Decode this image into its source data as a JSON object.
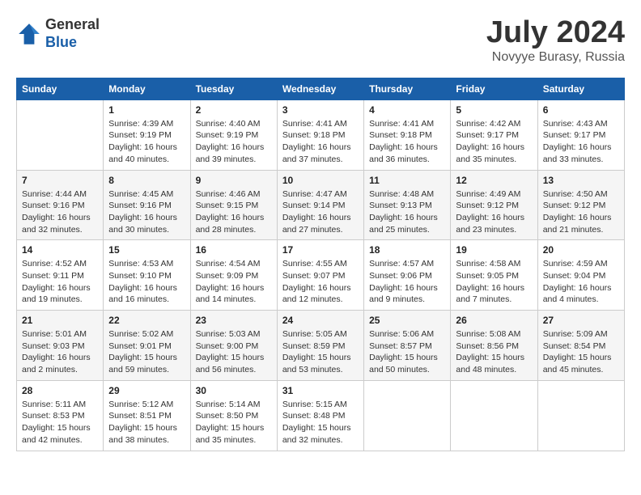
{
  "header": {
    "logo_general": "General",
    "logo_blue": "Blue",
    "month_title": "July 2024",
    "location": "Novyye Burasy, Russia"
  },
  "weekdays": [
    "Sunday",
    "Monday",
    "Tuesday",
    "Wednesday",
    "Thursday",
    "Friday",
    "Saturday"
  ],
  "weeks": [
    [
      {
        "day": "",
        "info": ""
      },
      {
        "day": "1",
        "info": "Sunrise: 4:39 AM\nSunset: 9:19 PM\nDaylight: 16 hours\nand 40 minutes."
      },
      {
        "day": "2",
        "info": "Sunrise: 4:40 AM\nSunset: 9:19 PM\nDaylight: 16 hours\nand 39 minutes."
      },
      {
        "day": "3",
        "info": "Sunrise: 4:41 AM\nSunset: 9:18 PM\nDaylight: 16 hours\nand 37 minutes."
      },
      {
        "day": "4",
        "info": "Sunrise: 4:41 AM\nSunset: 9:18 PM\nDaylight: 16 hours\nand 36 minutes."
      },
      {
        "day": "5",
        "info": "Sunrise: 4:42 AM\nSunset: 9:17 PM\nDaylight: 16 hours\nand 35 minutes."
      },
      {
        "day": "6",
        "info": "Sunrise: 4:43 AM\nSunset: 9:17 PM\nDaylight: 16 hours\nand 33 minutes."
      }
    ],
    [
      {
        "day": "7",
        "info": "Sunrise: 4:44 AM\nSunset: 9:16 PM\nDaylight: 16 hours\nand 32 minutes."
      },
      {
        "day": "8",
        "info": "Sunrise: 4:45 AM\nSunset: 9:16 PM\nDaylight: 16 hours\nand 30 minutes."
      },
      {
        "day": "9",
        "info": "Sunrise: 4:46 AM\nSunset: 9:15 PM\nDaylight: 16 hours\nand 28 minutes."
      },
      {
        "day": "10",
        "info": "Sunrise: 4:47 AM\nSunset: 9:14 PM\nDaylight: 16 hours\nand 27 minutes."
      },
      {
        "day": "11",
        "info": "Sunrise: 4:48 AM\nSunset: 9:13 PM\nDaylight: 16 hours\nand 25 minutes."
      },
      {
        "day": "12",
        "info": "Sunrise: 4:49 AM\nSunset: 9:12 PM\nDaylight: 16 hours\nand 23 minutes."
      },
      {
        "day": "13",
        "info": "Sunrise: 4:50 AM\nSunset: 9:12 PM\nDaylight: 16 hours\nand 21 minutes."
      }
    ],
    [
      {
        "day": "14",
        "info": "Sunrise: 4:52 AM\nSunset: 9:11 PM\nDaylight: 16 hours\nand 19 minutes."
      },
      {
        "day": "15",
        "info": "Sunrise: 4:53 AM\nSunset: 9:10 PM\nDaylight: 16 hours\nand 16 minutes."
      },
      {
        "day": "16",
        "info": "Sunrise: 4:54 AM\nSunset: 9:09 PM\nDaylight: 16 hours\nand 14 minutes."
      },
      {
        "day": "17",
        "info": "Sunrise: 4:55 AM\nSunset: 9:07 PM\nDaylight: 16 hours\nand 12 minutes."
      },
      {
        "day": "18",
        "info": "Sunrise: 4:57 AM\nSunset: 9:06 PM\nDaylight: 16 hours\nand 9 minutes."
      },
      {
        "day": "19",
        "info": "Sunrise: 4:58 AM\nSunset: 9:05 PM\nDaylight: 16 hours\nand 7 minutes."
      },
      {
        "day": "20",
        "info": "Sunrise: 4:59 AM\nSunset: 9:04 PM\nDaylight: 16 hours\nand 4 minutes."
      }
    ],
    [
      {
        "day": "21",
        "info": "Sunrise: 5:01 AM\nSunset: 9:03 PM\nDaylight: 16 hours\nand 2 minutes."
      },
      {
        "day": "22",
        "info": "Sunrise: 5:02 AM\nSunset: 9:01 PM\nDaylight: 15 hours\nand 59 minutes."
      },
      {
        "day": "23",
        "info": "Sunrise: 5:03 AM\nSunset: 9:00 PM\nDaylight: 15 hours\nand 56 minutes."
      },
      {
        "day": "24",
        "info": "Sunrise: 5:05 AM\nSunset: 8:59 PM\nDaylight: 15 hours\nand 53 minutes."
      },
      {
        "day": "25",
        "info": "Sunrise: 5:06 AM\nSunset: 8:57 PM\nDaylight: 15 hours\nand 50 minutes."
      },
      {
        "day": "26",
        "info": "Sunrise: 5:08 AM\nSunset: 8:56 PM\nDaylight: 15 hours\nand 48 minutes."
      },
      {
        "day": "27",
        "info": "Sunrise: 5:09 AM\nSunset: 8:54 PM\nDaylight: 15 hours\nand 45 minutes."
      }
    ],
    [
      {
        "day": "28",
        "info": "Sunrise: 5:11 AM\nSunset: 8:53 PM\nDaylight: 15 hours\nand 42 minutes."
      },
      {
        "day": "29",
        "info": "Sunrise: 5:12 AM\nSunset: 8:51 PM\nDaylight: 15 hours\nand 38 minutes."
      },
      {
        "day": "30",
        "info": "Sunrise: 5:14 AM\nSunset: 8:50 PM\nDaylight: 15 hours\nand 35 minutes."
      },
      {
        "day": "31",
        "info": "Sunrise: 5:15 AM\nSunset: 8:48 PM\nDaylight: 15 hours\nand 32 minutes."
      },
      {
        "day": "",
        "info": ""
      },
      {
        "day": "",
        "info": ""
      },
      {
        "day": "",
        "info": ""
      }
    ]
  ]
}
